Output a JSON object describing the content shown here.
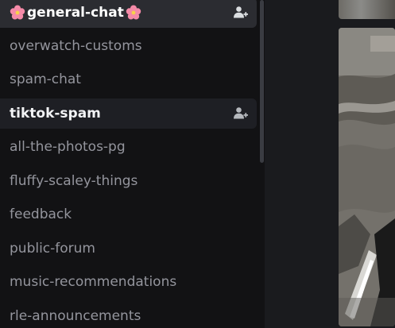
{
  "sidebar": {
    "channels": [
      {
        "label": "general-chat",
        "state": "selected",
        "emoji": "cherry-blossom",
        "has_member_icon": true
      },
      {
        "label": "overwatch-customs",
        "state": "normal"
      },
      {
        "label": "spam-chat",
        "state": "normal"
      },
      {
        "label": "tiktok-spam",
        "state": "unread",
        "has_member_icon": true
      },
      {
        "label": "all-the-photos-pg",
        "state": "normal"
      },
      {
        "label": "fluffy-scaley-things",
        "state": "normal"
      },
      {
        "label": "feedback",
        "state": "normal"
      },
      {
        "label": "public-forum",
        "state": "normal"
      },
      {
        "label": "music-recommendations",
        "state": "normal"
      },
      {
        "label": "rle-announcements",
        "state": "normal"
      }
    ]
  },
  "colors": {
    "sidebar_bg": "#121214",
    "selected_bg": "#2b2c31",
    "text_muted": "#94959d",
    "text_active": "#ffffff"
  }
}
